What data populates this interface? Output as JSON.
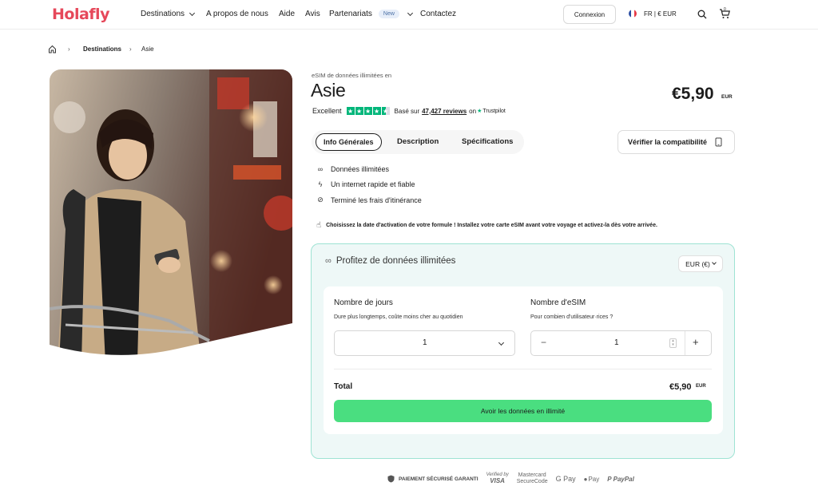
{
  "header": {
    "logo": "Holafly",
    "nav": [
      {
        "label": "Destinations",
        "dropdown": true
      },
      {
        "label": "A propos de nous"
      },
      {
        "label": "Aide"
      },
      {
        "label": "Avis"
      },
      {
        "label": "Partenariats",
        "badge": "New",
        "dropdown": true
      },
      {
        "label": "Contactez"
      }
    ],
    "login_label": "Connexion",
    "lang_label": "FR | € EUR",
    "cart_count": "0"
  },
  "breadcrumb": {
    "home_icon": "home-icon",
    "items": [
      "Destinations",
      "Asie"
    ]
  },
  "product": {
    "pre_title": "eSIM de données illimitées en",
    "title": "Asie",
    "price": "€5,90",
    "currency": "EUR",
    "rating_word": "Excellent",
    "rating_based": "Basé sur",
    "reviews": "47,427 reviews",
    "on": "on",
    "trustpilot": "Trustpilot"
  },
  "tabs": [
    "Info Générales",
    "Description",
    "Spécifications"
  ],
  "compat_label": "Vérifier la compatibilité",
  "features": [
    {
      "icon": "infinity-icon",
      "text": "Données illimitées"
    },
    {
      "icon": "bolt-icon",
      "text": "Un internet rapide et fiable"
    },
    {
      "icon": "no-roaming-icon",
      "text": "Terminé les frais d'itinérance"
    }
  ],
  "notice": "Choisissez la date d'activation de votre formule ! Installez votre carte eSIM avant votre voyage et activez-la dès votre arrivée.",
  "plan": {
    "title": "Profitez de données illimitées",
    "currency_select": "EUR (€)",
    "days_label": "Nombre de jours",
    "days_sub": "Dure plus longtemps, coûte moins cher au quotidien",
    "days_value": "1",
    "esim_label": "Nombre d'eSIM",
    "esim_sub": "Pour combien d'utilisateur·rices ?",
    "esim_value": "1",
    "total_label": "Total",
    "total_price": "€5,90",
    "total_currency": "EUR",
    "cta": "Avoir les données en illimité"
  },
  "payment": {
    "secure": "PAIEMENT SÉCURISÉ GARANTI",
    "verified_line1": "Verified by",
    "verified_line2": "VISA",
    "mastercard_line1": "Mastercard",
    "mastercard_line2": "SecureCode",
    "gpay": "G Pay",
    "applepay": "Pay",
    "paypal": "PayPal"
  },
  "colors": {
    "brand": "#e6485a",
    "cta": "#4ade80",
    "box_bg": "#eef8f7",
    "box_border": "#9ee3d3",
    "trustpilot": "#00b67a"
  }
}
